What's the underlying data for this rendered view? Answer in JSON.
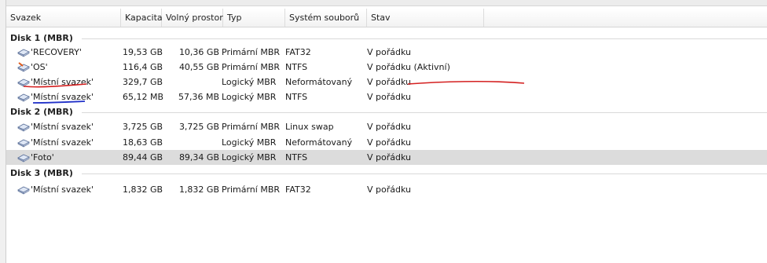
{
  "columns": {
    "volume": "Svazek",
    "capacity": "Kapacita",
    "free": "Volný prostor",
    "type": "Typ",
    "fs": "Systém souborů",
    "status": "Stav"
  },
  "groups": [
    {
      "label": "Disk 1 (MBR)",
      "rows": [
        {
          "name": "'RECOVERY'",
          "capacity": "19,53 GB",
          "free": "10,36 GB",
          "type": "Primární MBR",
          "fs": "FAT32",
          "status": "V pořádku",
          "icon": "volume-icon"
        },
        {
          "name": "'OS'",
          "capacity": "116,4 GB",
          "free": "40,55 GB",
          "type": "Primární MBR",
          "fs": "NTFS",
          "status": "V pořádku (Aktivní)",
          "icon": "active-volume-icon"
        },
        {
          "name": "'Místní svazek'",
          "capacity": "329,7 GB",
          "free": "",
          "type": "Logický MBR",
          "fs": "Neformátovaný",
          "status": "V pořádku",
          "icon": "volume-icon"
        },
        {
          "name": "'Místní svazek'",
          "capacity": "65,12 MB",
          "free": "57,36 MB",
          "type": "Logický MBR",
          "fs": "NTFS",
          "status": "V pořádku",
          "icon": "volume-icon"
        }
      ]
    },
    {
      "label": "Disk 2 (MBR)",
      "rows": [
        {
          "name": "'Místní svazek'",
          "capacity": "3,725 GB",
          "free": "3,725 GB",
          "type": "Primární MBR",
          "fs": "Linux swap",
          "status": "V pořádku",
          "icon": "volume-icon"
        },
        {
          "name": "'Místní svazek'",
          "capacity": "18,63 GB",
          "free": "",
          "type": "Logický MBR",
          "fs": "Neformátovaný",
          "status": "V pořádku",
          "icon": "volume-icon"
        },
        {
          "name": "'Foto'",
          "capacity": "89,44 GB",
          "free": "89,34 GB",
          "type": "Logický MBR",
          "fs": "NTFS",
          "status": "V pořádku",
          "icon": "volume-icon"
        }
      ]
    },
    {
      "label": "Disk 3 (MBR)",
      "rows": [
        {
          "name": "'Místní svazek'",
          "capacity": "1,832 GB",
          "free": "1,832 GB",
          "type": "Primární MBR",
          "fs": "FAT32",
          "status": "V pořádku",
          "icon": "volume-icon"
        }
      ]
    }
  ],
  "colors": {
    "annotation_red": "#d42020",
    "annotation_blue": "#2030c8",
    "selected_row": "#dcdcdc"
  }
}
